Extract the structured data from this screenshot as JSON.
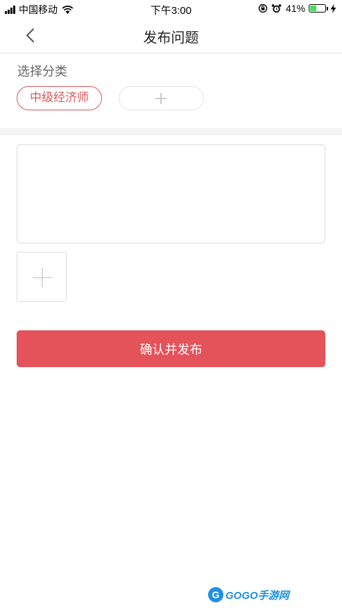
{
  "status_bar": {
    "carrier": "中国移动",
    "time": "下午3:00",
    "battery": "41%",
    "battery_level": 0.41
  },
  "nav": {
    "title": "发布问题"
  },
  "category": {
    "label": "选择分类",
    "selected_tag": "中级经济师"
  },
  "form": {
    "content_value": "",
    "submit_label": "确认并发布"
  },
  "colors": {
    "accent": "#e4525a",
    "tag_border": "#d9575d"
  },
  "watermark": {
    "badge": "G",
    "text": "GOGO手游网"
  }
}
